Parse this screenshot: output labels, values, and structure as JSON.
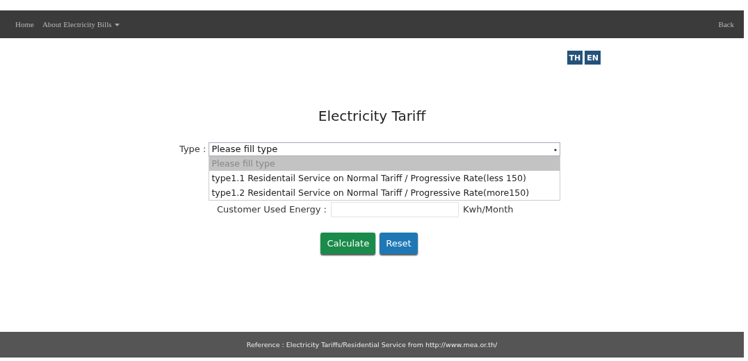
{
  "navbar": {
    "items": [
      {
        "label": "Home",
        "kind": "link"
      },
      {
        "label": "About Electricity Bills",
        "kind": "dropdown"
      }
    ],
    "back": "Back"
  },
  "languages": [
    "TH",
    "EN"
  ],
  "title": "Electricity Tariff",
  "type_field": {
    "label": "Type :",
    "value": "Please fill type",
    "options": [
      {
        "label": "Please fill type",
        "selected": true
      },
      {
        "label": "type1.1 Residentail Service on Normal Tariff / Progressive Rate(less 150)",
        "selected": false
      },
      {
        "label": "type1.2 Residentail Service on Normal Tariff / Progressive Rate(more150)",
        "selected": false
      }
    ]
  },
  "energy_field": {
    "label": "Customer Used Energy :",
    "unit": "Kwh/Month"
  },
  "buttons": [
    {
      "label": "Calculate",
      "kind": "primary"
    },
    {
      "label": "Reset",
      "kind": "secondary"
    }
  ],
  "footer": "Reference : Electricity Tariffs/Residential Service from http://www.mea.or.th/"
}
